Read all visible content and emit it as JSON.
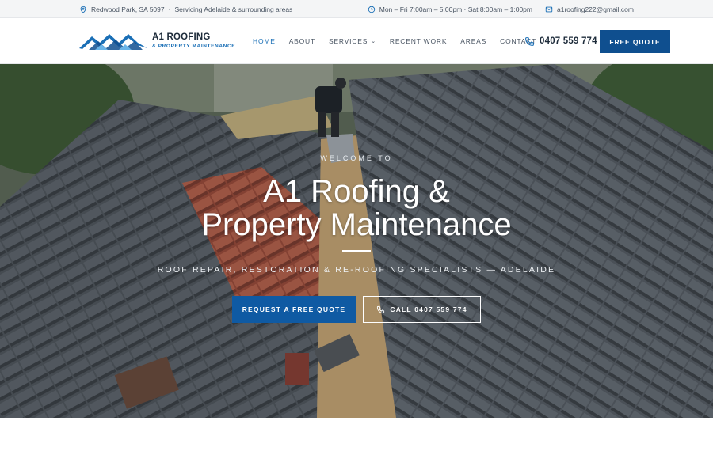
{
  "topbar": {
    "location": "Redwood Park, SA 5097",
    "separator": "·",
    "service_area": "Servicing Adelaide & surrounding areas",
    "hours": "Mon – Fri 7:00am – 5:00pm  ·  Sat 8:00am – 1:00pm",
    "email": "a1roofing222@gmail.com"
  },
  "header": {
    "logo_line1": "A1 ROOFING",
    "logo_line2": "& PROPERTY MAINTENANCE",
    "nav": [
      {
        "label": "HOME"
      },
      {
        "label": "ABOUT"
      },
      {
        "label": "SERVICES"
      },
      {
        "label": "RECENT WORK"
      },
      {
        "label": "AREAS"
      },
      {
        "label": "CONTACT"
      }
    ],
    "phone": "0407 559 774",
    "cta": "FREE QUOTE"
  },
  "hero": {
    "kicker": "WELCOME TO",
    "title_line1": "A1 Roofing &",
    "title_line2": "Property Maintenance",
    "subtitle": "ROOF REPAIR, RESTORATION & RE-ROOFING SPECIALISTS — ADELAIDE",
    "primary_button": "REQUEST A FREE QUOTE",
    "secondary_button": "CALL 0407 559 774"
  },
  "colors": {
    "brand_blue": "#0f4f8f",
    "accent_blue": "#1a6fb6",
    "tile_gray": "#4b5157",
    "tile_red": "#b5543d"
  },
  "icons": {
    "location": "map-pin-icon",
    "hours": "clock-icon",
    "email": "mail-icon",
    "phone": "phone-icon",
    "dropdown": "chevron-down-icon"
  }
}
